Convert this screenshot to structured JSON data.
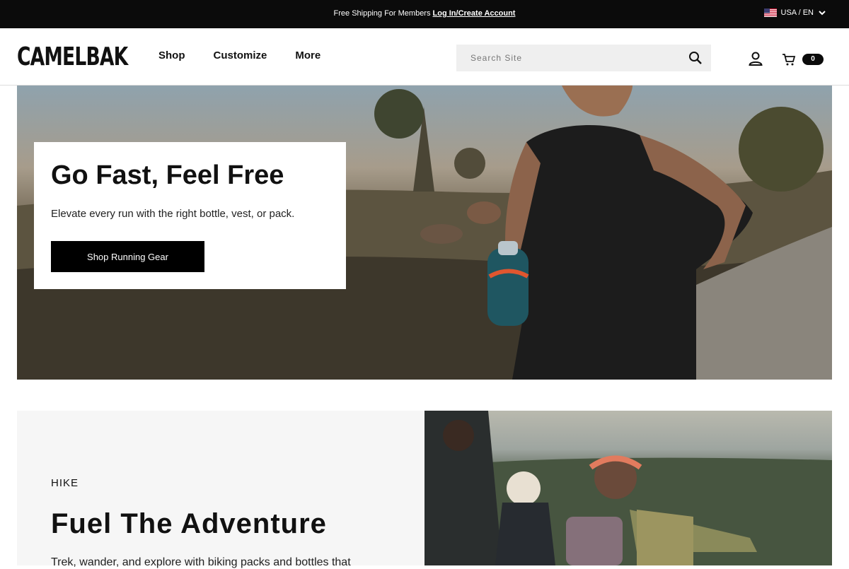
{
  "topbar": {
    "promo_text": "Free Shipping For Members ",
    "promo_link": "Log In/Create Account",
    "locale": "USA / EN"
  },
  "header": {
    "logo": "CAMELBAK",
    "nav": [
      "Shop",
      "Customize",
      "More"
    ],
    "search_placeholder": "Search Site",
    "cart_count": "0"
  },
  "hero": {
    "title": "Go Fast, Feel Free",
    "subtitle": "Elevate every run with the right bottle, vest, or pack.",
    "cta": "Shop Running Gear"
  },
  "hike": {
    "eyebrow": "HIKE",
    "title": "Fuel The Adventure",
    "body": "Trek, wander, and explore with biking packs and bottles that"
  }
}
